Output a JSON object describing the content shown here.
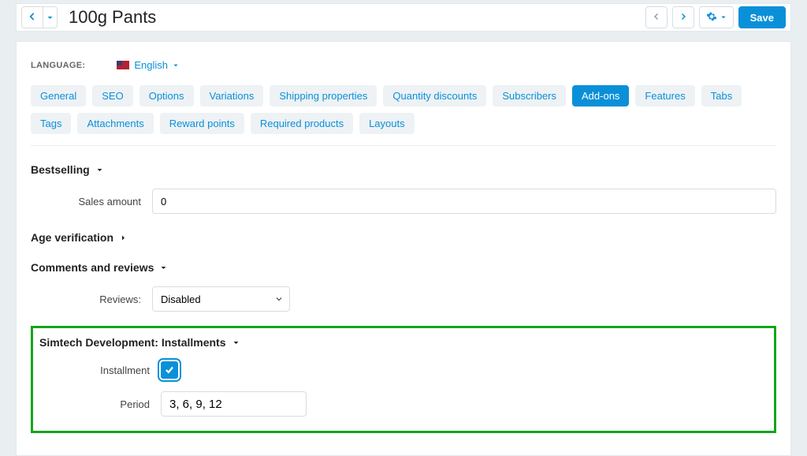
{
  "header": {
    "title": "100g Pants",
    "save_label": "Save"
  },
  "language_row": {
    "label": "LANGUAGE:",
    "current": "English"
  },
  "tabs": [
    {
      "label": "General"
    },
    {
      "label": "SEO"
    },
    {
      "label": "Options"
    },
    {
      "label": "Variations"
    },
    {
      "label": "Shipping properties"
    },
    {
      "label": "Quantity discounts"
    },
    {
      "label": "Subscribers"
    },
    {
      "label": "Add-ons",
      "active": true
    },
    {
      "label": "Features"
    },
    {
      "label": "Tabs"
    },
    {
      "label": "Tags"
    },
    {
      "label": "Attachments"
    },
    {
      "label": "Reward points"
    },
    {
      "label": "Required products"
    },
    {
      "label": "Layouts"
    }
  ],
  "sections": {
    "bestselling": {
      "title": "Bestselling",
      "expanded": true,
      "sales_amount_label": "Sales amount",
      "sales_amount_value": "0"
    },
    "age_verification": {
      "title": "Age verification",
      "expanded": false
    },
    "comments": {
      "title": "Comments and reviews",
      "expanded": true,
      "reviews_label": "Reviews:",
      "reviews_value": "Disabled"
    },
    "installments": {
      "title": "Simtech Development: Installments",
      "expanded": true,
      "installment_label": "Installment",
      "installment_checked": true,
      "period_label": "Period",
      "period_value": "3, 6, 9, 12"
    }
  }
}
